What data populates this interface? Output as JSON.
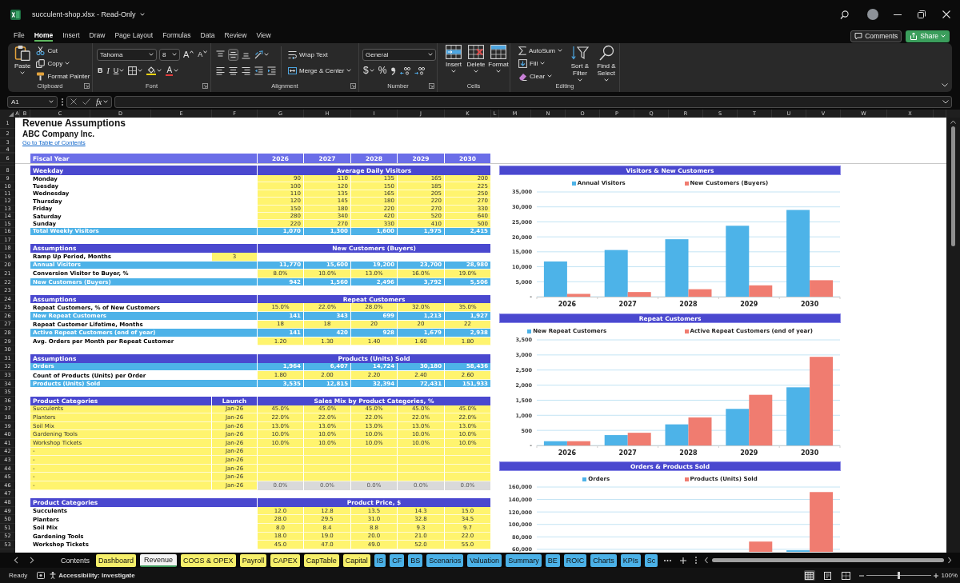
{
  "window": {
    "title": "succulent-shop.xlsx - Read-Only"
  },
  "menu_tabs": [
    {
      "label": "File",
      "selected": false
    },
    {
      "label": "Home",
      "selected": true
    },
    {
      "label": "Insert",
      "selected": false
    },
    {
      "label": "Draw",
      "selected": false
    },
    {
      "label": "Page Layout",
      "selected": false
    },
    {
      "label": "Formulas",
      "selected": false
    },
    {
      "label": "Data",
      "selected": false
    },
    {
      "label": "Review",
      "selected": false
    },
    {
      "label": "View",
      "selected": false
    }
  ],
  "header_buttons": [
    {
      "kind": "outline",
      "label": "Comments"
    },
    {
      "kind": "primary",
      "label": "Share",
      "menu": true
    }
  ],
  "ribbon": {
    "groups": [
      {
        "label": "Clipboard",
        "launcher": true,
        "columns": [
          {
            "kind": "large",
            "label": "Paste",
            "menu": true
          },
          {
            "kind": "stack",
            "rows": [
              {
                "items": [
                  {
                    "kind": "small",
                    "label": "Cut"
                  }
                ]
              },
              {
                "items": [
                  {
                    "kind": "small",
                    "label": "Copy",
                    "menu": true
                  }
                ]
              },
              {
                "items": [
                  {
                    "kind": "small",
                    "label": "Format Painter"
                  }
                ]
              }
            ]
          }
        ]
      },
      {
        "label": "Font",
        "launcher": true,
        "columns": [
          {
            "kind": "stack",
            "rows": [
              {
                "items": [
                  {
                    "kind": "field",
                    "value": "Tahoma"
                  },
                  {
                    "kind": "field",
                    "value": "8"
                  },
                  {
                    "kind": "glyph",
                    "label": "A"
                  },
                  {
                    "kind": "glyph",
                    "label": "A"
                  }
                ]
              },
              {
                "items": [
                  {
                    "kind": "glyph",
                    "label": "B"
                  },
                  {
                    "kind": "glyph",
                    "label": "I"
                  },
                  {
                    "kind": "glyph",
                    "label": "U",
                    "menu": true
                  },
                  {
                    "kind": "tool",
                    "menu": true
                  },
                  {
                    "kind": "tool",
                    "menu": true
                  },
                  {
                    "kind": "glyph",
                    "label": "A",
                    "menu": true
                  }
                ]
              }
            ]
          }
        ]
      },
      {
        "label": "Alignment",
        "launcher": true,
        "columns": [
          {
            "kind": "stack",
            "rows": [
              {
                "items": [
                  {
                    "kind": "tool",
                    "on": false
                  },
                  {
                    "kind": "tool",
                    "on": true
                  },
                  {
                    "kind": "tool",
                    "on": false
                  },
                  {
                    "kind": "tool",
                    "on": false,
                    "menu": true
                  }
                ]
              },
              {
                "items": [
                  {
                    "kind": "tool",
                    "on": false
                  },
                  {
                    "kind": "tool",
                    "on": false
                  },
                  {
                    "kind": "tool",
                    "on": false
                  },
                  {
                    "kind": "tool",
                    "on": false
                  },
                  {
                    "kind": "tool",
                    "on": false
                  }
                ]
              }
            ]
          },
          {
            "kind": "stack",
            "rows": [
              {
                "items": [
                  {
                    "kind": "small",
                    "label": "Wrap Text"
                  }
                ]
              },
              {
                "items": [
                  {
                    "kind": "small",
                    "label": "Merge & Center",
                    "menu": true
                  }
                ]
              }
            ]
          }
        ]
      },
      {
        "label": "Number",
        "launcher": true,
        "columns": [
          {
            "kind": "stack",
            "rows": [
              {
                "items": [
                  {
                    "kind": "field",
                    "value": "General"
                  }
                ]
              },
              {
                "items": [
                  {
                    "kind": "glyph",
                    "label": "$",
                    "menu": true
                  },
                  {
                    "kind": "glyph",
                    "label": "%"
                  },
                  {
                    "kind": "tool"
                  },
                  {
                    "kind": "tool"
                  },
                  {
                    "kind": "tool"
                  }
                ]
              }
            ]
          }
        ]
      },
      {
        "label": "Cells",
        "columns": [
          {
            "kind": "large",
            "label": "Insert",
            "menu": true
          },
          {
            "kind": "large",
            "label": "Delete",
            "menu": true
          },
          {
            "kind": "large",
            "label": "Format",
            "menu": true
          }
        ]
      },
      {
        "label": "Editing",
        "columns": [
          {
            "kind": "stack",
            "rows": [
              {
                "items": [
                  {
                    "kind": "small",
                    "label": "AutoSum",
                    "menu": true
                  }
                ]
              },
              {
                "items": [
                  {
                    "kind": "small",
                    "label": "Fill",
                    "menu": true
                  }
                ]
              },
              {
                "items": [
                  {
                    "kind": "small",
                    "label": "Clear",
                    "menu": true
                  }
                ]
              }
            ]
          },
          {
            "kind": "large",
            "label": "Sort & Filter",
            "menu": true
          },
          {
            "kind": "large",
            "label": "Find & Select",
            "menu": true
          }
        ]
      }
    ]
  },
  "formula_bar": {
    "name_box": "A1",
    "function_label": "fx"
  },
  "sheet": {
    "columns": [
      "A",
      "B",
      "C",
      "D",
      "E",
      "F",
      "G",
      "H",
      "I",
      "J",
      "K",
      "L",
      "M",
      "N",
      "O",
      "P",
      "Q",
      "R",
      "S",
      "T",
      "U",
      "V",
      "W",
      "X"
    ],
    "row_numbers": [
      "1",
      "2",
      "3",
      "4",
      "6",
      "8",
      "9",
      "10",
      "11",
      "12",
      "13",
      "14",
      "15",
      "16",
      "17",
      "18",
      "19",
      "20",
      "21",
      "22",
      "23",
      "24",
      "25",
      "26",
      "27",
      "28",
      "29",
      "30",
      "31",
      "32",
      "33",
      "34",
      "35",
      "36",
      "37",
      "38",
      "39",
      "40",
      "41",
      "42",
      "43",
      "44",
      "45",
      "46",
      "47",
      "48",
      "49",
      "50",
      "51",
      "52",
      "53"
    ],
    "title": "Revenue Assumptions",
    "company": "ABC Company Inc.",
    "link": "Go to Table of Contents",
    "fiscal_year": {
      "label": "Fiscal Year",
      "years": [
        "2026",
        "2027",
        "2028",
        "2029",
        "2030"
      ]
    },
    "sections": [
      {
        "header": "Weekday",
        "title": "Average Daily Visitors",
        "rows": [
          {
            "label": "Monday",
            "kind": "count",
            "values": [
              "90",
              "110",
              "135",
              "165",
              "200"
            ]
          },
          {
            "label": "Tuesday",
            "kind": "count",
            "values": [
              "100",
              "120",
              "150",
              "185",
              "225"
            ]
          },
          {
            "label": "Wednesday",
            "kind": "count",
            "values": [
              "110",
              "135",
              "165",
              "205",
              "250"
            ]
          },
          {
            "label": "Thursday",
            "kind": "count",
            "values": [
              "120",
              "145",
              "180",
              "220",
              "270"
            ]
          },
          {
            "label": "Friday",
            "kind": "count",
            "values": [
              "150",
              "180",
              "220",
              "270",
              "330"
            ]
          },
          {
            "label": "Saturday",
            "kind": "count",
            "values": [
              "280",
              "340",
              "420",
              "520",
              "640"
            ]
          },
          {
            "label": "Sunday",
            "kind": "count",
            "values": [
              "220",
              "270",
              "330",
              "410",
              "500"
            ]
          },
          {
            "label": "Total Weekly Visitors",
            "kind": "total",
            "values": [
              "1,070",
              "1,300",
              "1,600",
              "1,975",
              "2,415"
            ]
          }
        ]
      },
      {
        "header": "Assumptions",
        "title": "New Customers (Buyers)",
        "rows": [
          {
            "label": "Ramp Up Period, Months",
            "kind": "single",
            "value": "3"
          },
          {
            "label": "Annual Visitors",
            "kind": "total",
            "values": [
              "11,770",
              "15,600",
              "19,200",
              "23,700",
              "28,980"
            ]
          },
          {
            "label": "Conversion Visitor to Buyer, %",
            "kind": "rate",
            "values": [
              "8.0%",
              "10.0%",
              "13.0%",
              "16.0%",
              "19.0%"
            ]
          },
          {
            "label": "New Customers (Buyers)",
            "kind": "total",
            "values": [
              "942",
              "1,560",
              "2,496",
              "3,792",
              "5,506"
            ]
          }
        ]
      },
      {
        "header": "Assumptions",
        "title": "Repeat Customers",
        "rows": [
          {
            "label": "Repeat Customers, % of New Customers",
            "kind": "rate",
            "values": [
              "15.0%",
              "22.0%",
              "28.0%",
              "32.0%",
              "35.0%"
            ]
          },
          {
            "label": "New Repeat Customers",
            "kind": "total",
            "values": [
              "141",
              "343",
              "699",
              "1,213",
              "1,927"
            ]
          },
          {
            "label": "Repeat Customer Lifetime, Months",
            "kind": "rate",
            "values": [
              "18",
              "18",
              "20",
              "20",
              "22"
            ]
          },
          {
            "label": "Active Repeat Customers (end of year)",
            "kind": "total",
            "values": [
              "141",
              "420",
              "928",
              "1,679",
              "2,938"
            ]
          },
          {
            "label": "Avg. Orders per Month per Repeat Customer",
            "kind": "rate",
            "values": [
              "1.20",
              "1.30",
              "1.40",
              "1.60",
              "1.80"
            ]
          }
        ]
      },
      {
        "header": "Assumptions",
        "title": "Products (Units) Sold",
        "rows": [
          {
            "label": "Orders",
            "kind": "total",
            "values": [
              "1,964",
              "6,407",
              "14,724",
              "30,180",
              "58,436"
            ]
          },
          {
            "label": "Count of Products (Units) per Order",
            "kind": "rate",
            "values": [
              "1.80",
              "2.00",
              "2.20",
              "2.40",
              "2.60"
            ]
          },
          {
            "label": "Products (Units) Sold",
            "kind": "total",
            "values": [
              "3,535",
              "12,815",
              "32,394",
              "72,431",
              "151,933"
            ]
          }
        ]
      },
      {
        "header": "Product Categories",
        "launch": "Launch",
        "title": "Sales Mix by Product Categories, %",
        "rows": [
          {
            "label": "Succulents",
            "kind": "mix",
            "launch": "Jan-26",
            "values": [
              "45.0%",
              "45.0%",
              "45.0%",
              "45.0%",
              "45.0%"
            ]
          },
          {
            "label": "Planters",
            "kind": "mix",
            "launch": "Jan-26",
            "values": [
              "22.0%",
              "22.0%",
              "22.0%",
              "22.0%",
              "22.0%"
            ]
          },
          {
            "label": "Soil Mix",
            "kind": "mix",
            "launch": "Jan-26",
            "values": [
              "13.0%",
              "13.0%",
              "13.0%",
              "13.0%",
              "13.0%"
            ]
          },
          {
            "label": "Gardening Tools",
            "kind": "mix",
            "launch": "Jan-26",
            "values": [
              "10.0%",
              "10.0%",
              "10.0%",
              "10.0%",
              "10.0%"
            ]
          },
          {
            "label": "Workshop Tickets",
            "kind": "mix",
            "launch": "Jan-26",
            "values": [
              "10.0%",
              "10.0%",
              "10.0%",
              "10.0%",
              "10.0%"
            ]
          },
          {
            "label": "-",
            "kind": "mix",
            "launch": "Jan-26"
          },
          {
            "label": "-",
            "kind": "mix",
            "launch": "Jan-26"
          },
          {
            "label": "-",
            "kind": "mix",
            "launch": "Jan-26"
          },
          {
            "label": "-",
            "kind": "mix",
            "launch": "Jan-26"
          },
          {
            "label": "-",
            "kind": "check",
            "launch": "Jan-26",
            "values": [
              "0.0%",
              "0.0%",
              "0.0%",
              "0.0%",
              "0.0%"
            ]
          }
        ]
      },
      {
        "header": "Product Categories",
        "title": "Product Price, $",
        "rows": [
          {
            "label": "Succulents",
            "kind": "rate",
            "values": [
              "12.0",
              "12.8",
              "13.5",
              "14.3",
              "15.0"
            ]
          },
          {
            "label": "Planters",
            "kind": "rate",
            "values": [
              "28.0",
              "29.5",
              "31.0",
              "32.8",
              "34.5"
            ]
          },
          {
            "label": "Soil Mix",
            "kind": "rate",
            "values": [
              "8.0",
              "8.4",
              "8.8",
              "9.3",
              "9.7"
            ]
          },
          {
            "label": "Gardening Tools",
            "kind": "rate",
            "values": [
              "18.0",
              "19.0",
              "20.0",
              "21.0",
              "22.0"
            ]
          },
          {
            "label": "Workshop Tickets",
            "kind": "rate",
            "values": [
              "45.0",
              "47.0",
              "49.0",
              "52.0",
              "55.0"
            ]
          }
        ]
      }
    ],
    "charts": [
      {
        "chart_data": {
          "type": "bar",
          "title": "Visitors & New Customers",
          "legend": "top",
          "grid": true,
          "categories": [
            "2026",
            "2027",
            "2028",
            "2029",
            "2030"
          ],
          "series": [
            {
              "name": "Annual Visitors",
              "color": "#4db3e8",
              "values": [
                11770,
                15600,
                19200,
                23700,
                28980
              ]
            },
            {
              "name": "New Customers (Buyers)",
              "color": "#f07c70",
              "values": [
                942,
                1560,
                2496,
                3792,
                5506
              ]
            }
          ],
          "ylim": [
            0,
            35000
          ],
          "yticks": [
            {
              "value": 0,
              "label": "-"
            },
            {
              "value": 5000,
              "label": "5,000"
            },
            {
              "value": 10000,
              "label": "10,000"
            },
            {
              "value": 15000,
              "label": "15,000"
            },
            {
              "value": 20000,
              "label": "20,000"
            },
            {
              "value": 25000,
              "label": "25,000"
            },
            {
              "value": 30000,
              "label": "30,000"
            },
            {
              "value": 35000,
              "label": "35,000"
            }
          ]
        }
      },
      {
        "chart_data": {
          "type": "bar",
          "title": "Repeat Customers",
          "legend": "top",
          "grid": true,
          "categories": [
            "2026",
            "2027",
            "2028",
            "2029",
            "2030"
          ],
          "series": [
            {
              "name": "New Repeat Customers",
              "color": "#4db3e8",
              "values": [
                141,
                343,
                699,
                1213,
                1927
              ]
            },
            {
              "name": "Active Repeat Customers (end of year)",
              "color": "#f07c70",
              "values": [
                141,
                420,
                928,
                1679,
                2938
              ]
            }
          ],
          "ylim": [
            0,
            3500
          ],
          "yticks": [
            {
              "value": 0,
              "label": "-"
            },
            {
              "value": 500,
              "label": "500"
            },
            {
              "value": 1000,
              "label": "1,000"
            },
            {
              "value": 1500,
              "label": "1,500"
            },
            {
              "value": 2000,
              "label": "2,000"
            },
            {
              "value": 2500,
              "label": "2,500"
            },
            {
              "value": 3000,
              "label": "3,000"
            },
            {
              "value": 3500,
              "label": "3,500"
            }
          ]
        }
      },
      {
        "chart_data": {
          "type": "bar",
          "title": "Orders & Products Sold",
          "legend": "top",
          "grid": true,
          "series": [
            {
              "name": "Orders",
              "color": "#4db3e8",
              "values": [
                null,
                null,
                null,
                null,
                58436
              ]
            },
            {
              "name": "Products (Units) Sold",
              "color": "#f07c70",
              "values": [
                null,
                null,
                null,
                72431,
                151933
              ]
            }
          ],
          "ylim": [
            56000,
            160000
          ],
          "yticks": [
            {
              "value": 60000,
              "label": "60,000"
            },
            {
              "value": 80000,
              "label": "80,000"
            },
            {
              "value": 100000,
              "label": "100,000"
            },
            {
              "value": 120000,
              "label": "120,000"
            },
            {
              "value": 140000,
              "label": "140,000"
            },
            {
              "value": 160000,
              "label": "160,000"
            }
          ]
        }
      }
    ]
  },
  "sheet_tabs": [
    {
      "label": "Contents",
      "selected": false
    },
    {
      "label": "Dashboard",
      "selected": false,
      "color": "#f6ef6a"
    },
    {
      "label": "Revenue",
      "selected": true
    },
    {
      "label": "COGS & OPEX",
      "selected": false,
      "color": "#f6ef6a"
    },
    {
      "label": "Payroll",
      "selected": false,
      "color": "#f6ef6a"
    },
    {
      "label": "CAPEX",
      "selected": false,
      "color": "#f6ef6a"
    },
    {
      "label": "CapTable",
      "selected": false,
      "color": "#f6ef6a"
    },
    {
      "label": "Capital",
      "selected": false,
      "color": "#f6ef6a"
    },
    {
      "label": "IS",
      "selected": false,
      "color": "#4bb1e7"
    },
    {
      "label": "CF",
      "selected": false,
      "color": "#4bb1e7"
    },
    {
      "label": "BS",
      "selected": false,
      "color": "#4bb1e7"
    },
    {
      "label": "Scenarios",
      "selected": false,
      "color": "#4bb1e7"
    },
    {
      "label": "Valuation",
      "selected": false,
      "color": "#4bb1e7"
    },
    {
      "label": "Summary",
      "selected": false,
      "color": "#4bb1e7"
    },
    {
      "label": "BE",
      "selected": false,
      "color": "#4bb1e7"
    },
    {
      "label": "ROIC",
      "selected": false,
      "color": "#4bb1e7"
    },
    {
      "label": "Charts",
      "selected": false,
      "color": "#4bb1e7"
    },
    {
      "label": "KPIs",
      "selected": false,
      "color": "#4bb1e7"
    },
    {
      "label": "Sc",
      "selected": false,
      "color": "#4bb1e7"
    }
  ],
  "status_bar": {
    "status": "Ready",
    "accessibility": "Accessibility: Investigate",
    "views": [
      {
        "selected": true
      },
      {
        "selected": false
      },
      {
        "selected": false
      }
    ],
    "zoom": {
      "level": 0.5,
      "value": "100%"
    }
  }
}
